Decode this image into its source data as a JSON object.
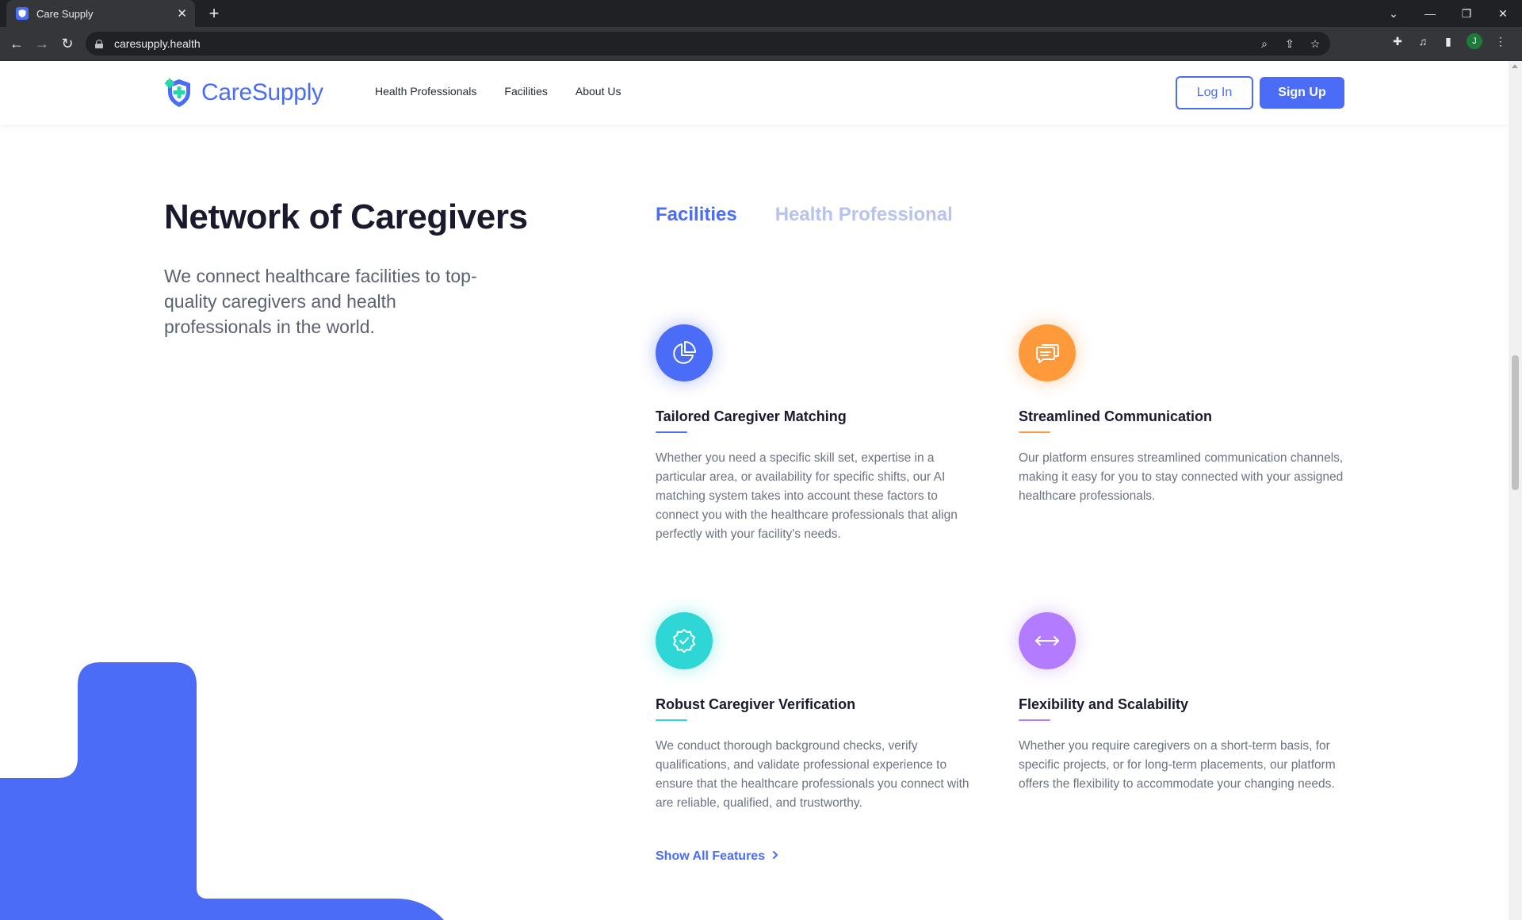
{
  "browser": {
    "tab_title": "Care Supply",
    "url": "caresupply.health",
    "profile_initial": "J"
  },
  "header": {
    "logo_text": "CareSupply",
    "nav": [
      "Health Professionals",
      "Facilities",
      "About Us"
    ],
    "login_label": "Log In",
    "signup_label": "Sign Up"
  },
  "hero": {
    "title": "Network of Caregivers",
    "subtitle": "We connect healthcare facilities to top-quality caregivers and health professionals in the world."
  },
  "tabs": {
    "active": "Facilities",
    "inactive": "Health Professional"
  },
  "features": [
    {
      "title": "Tailored Caregiver Matching",
      "description": "Whether you need a specific skill set, expertise in a particular area, or availability for specific shifts, our AI matching system takes into account these factors to connect you with the healthcare professionals that align perfectly with your facility's needs.",
      "icon": "pie-chart-icon",
      "color": "#4a6cf7"
    },
    {
      "title": "Streamlined Communication",
      "description": "Our platform ensures streamlined communication channels, making it easy for you to stay connected with your assigned healthcare professionals.",
      "icon": "chat-bubbles-icon",
      "color": "#ff9a3c"
    },
    {
      "title": "Robust Caregiver Verification",
      "description": "We conduct thorough background checks, verify qualifications, and validate professional experience to ensure that the healthcare professionals you connect with are reliable, qualified, and trustworthy.",
      "icon": "verified-badge-icon",
      "color": "#2ed6d6"
    },
    {
      "title": "Flexibility and Scalability",
      "description": "Whether you require caregivers on a short-term basis, for specific projects, or for long-term placements, our platform offers the flexibility to accommodate your changing needs.",
      "icon": "arrows-horizontal-icon",
      "color": "#b37bff"
    }
  ],
  "show_all_label": "Show All Features",
  "colors": {
    "brand": "#4a6cf7",
    "text_dark": "#1a1a2e",
    "text_muted": "#6b7280"
  }
}
